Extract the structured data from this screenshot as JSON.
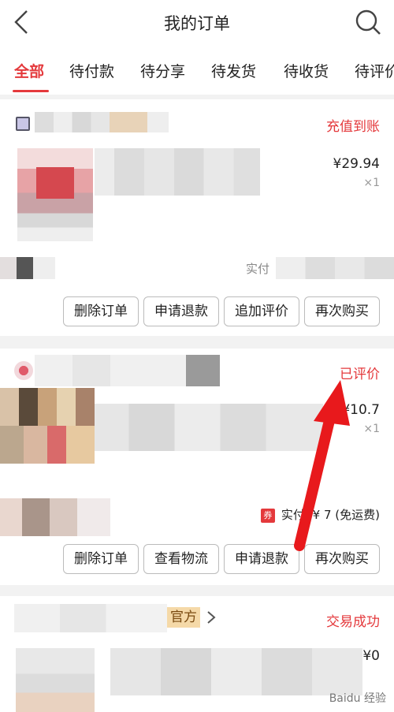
{
  "header": {
    "title": "我的订单",
    "back_icon": "chevron-left-icon",
    "search_icon": "search-icon"
  },
  "tabs": [
    {
      "label": "全部",
      "active": true
    },
    {
      "label": "待付款"
    },
    {
      "label": "待分享"
    },
    {
      "label": "待发货"
    },
    {
      "label": "待收货"
    },
    {
      "label": "待评价"
    }
  ],
  "orders": [
    {
      "status": "充值到账",
      "price": "¥29.94",
      "qty": "×1",
      "pay_text": "实付",
      "buttons": [
        "删除订单",
        "申请退款",
        "追加评价",
        "再次购买"
      ]
    },
    {
      "status": "已评价",
      "price": "¥10.7",
      "qty": "×1",
      "coupon": "券",
      "pay_text": "实付: ¥ 7 (免运费)",
      "buttons": [
        "删除订单",
        "查看物流",
        "申请退款",
        "再次购买"
      ]
    },
    {
      "official_tag": "官方",
      "status": "交易成功",
      "price": "¥0"
    }
  ],
  "watermark": "Baidu 经验",
  "colors": {
    "accent": "#e4393c",
    "arrow": "#e8191c"
  }
}
